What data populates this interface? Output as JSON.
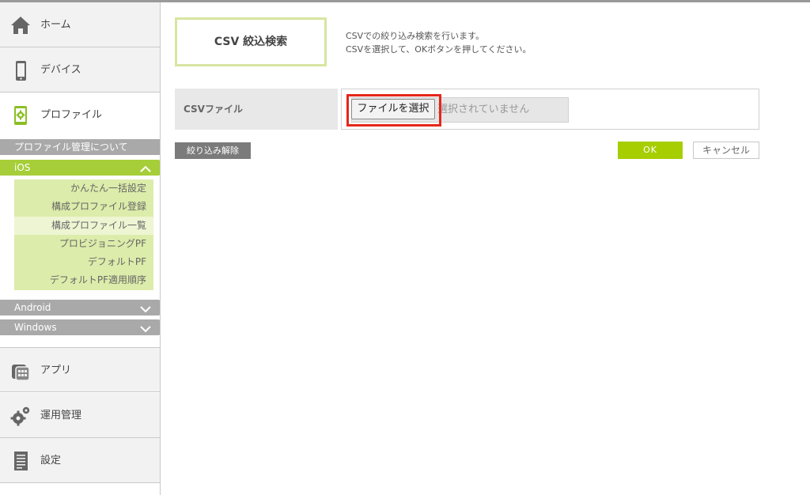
{
  "sidebar": {
    "home_label": "ホーム",
    "device_label": "デバイス",
    "profile_label": "プロファイル",
    "profile_about_label": "プロファイル管理について",
    "ios_label": "iOS",
    "ios_items": [
      "かんたん一括設定",
      "構成プロファイル登録",
      "構成プロファイル一覧",
      "プロビジョニングPF",
      "デフォルトPF",
      "デフォルトPF適用順序"
    ],
    "ios_current_index": 2,
    "android_label": "Android",
    "windows_label": "Windows",
    "app_label": "アプリ",
    "ops_label": "運用管理",
    "settings_label": "設定"
  },
  "main": {
    "title": "CSV 絞込検索",
    "description_lines": [
      "CSVでの絞り込み検索を行います。",
      "CSVを選択して、OKボタンを押してください。"
    ],
    "form_label": "CSVファイル",
    "file_button_label": "ファイルを選択",
    "file_status": "選択されていません",
    "clear_button_label": "絞り込み解除",
    "ok_button_label": "OK",
    "cancel_button_label": "キャンセル"
  },
  "colors": {
    "accent": "#a6ce39",
    "highlight": "#e5261b"
  },
  "icons": {
    "home": "home-icon",
    "device": "smartphone-icon",
    "profile": "profile-gear-icon",
    "app": "app-icon",
    "ops": "gears-icon",
    "settings": "document-icon"
  }
}
